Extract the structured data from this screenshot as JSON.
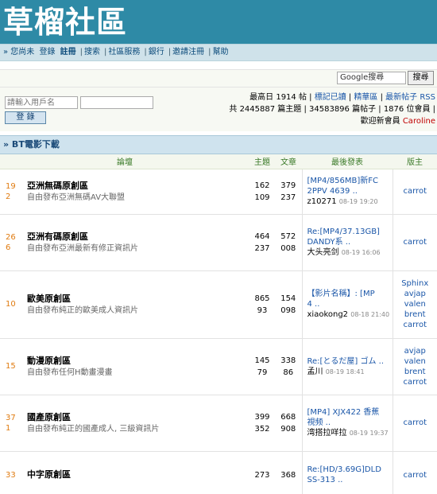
{
  "header": {
    "logo": "草榴社區"
  },
  "nav": {
    "greeting": "» 您尚未",
    "login": "登錄",
    "register": "註冊",
    "links": [
      "搜索",
      "社區服務",
      "銀行",
      "邀請注冊",
      "幫助"
    ]
  },
  "search": {
    "placeholder": "Google搜尋",
    "button": "搜尋"
  },
  "login": {
    "username_placeholder": "請輸入用戶名",
    "password_value": "",
    "button": "登 錄"
  },
  "stats": {
    "line1": "最高日 1914 帖 |",
    "link_attend": "標記已讀",
    "link_essence": "精華區",
    "link_newest": "最新帖子 RSS",
    "line2": "共 2445887 篇主題 | 34583896 篇帖子 | 1876 位會員 |",
    "welcome": "歡迎新會員",
    "new_member": "Caroline"
  },
  "section": {
    "title": "» BT電影下載"
  },
  "columns": {
    "forum": "論壇",
    "topics": "主題",
    "posts": "文章",
    "last": "最後發表",
    "mod": "版主"
  },
  "forums": [
    {
      "icon": [
        "19",
        "2"
      ],
      "name": "亞洲無碼原創區",
      "desc": "自由發布亞洲無碼AV大聯盟",
      "topics": [
        "162",
        "109"
      ],
      "posts": [
        "379",
        "237"
      ],
      "last": [
        "[MP4/856MB]新FC",
        "2PPV 4639 .."
      ],
      "last_user": "z10271",
      "last_date": "08-19 19:20",
      "mods": [
        "carrot"
      ]
    },
    {
      "icon": [
        "26",
        "6"
      ],
      "name": "亞洲有碼原創區",
      "desc": "自由發布亞洲最新有修正資訊片",
      "topics": [
        "464",
        "237"
      ],
      "posts": [
        "572",
        "008"
      ],
      "last": [
        "Re:[MP4/37.13GB]",
        "DANDY系 .."
      ],
      "last_user": "大头亮剑",
      "last_date": "08-19 16:06",
      "mods": [
        "carrot"
      ]
    },
    {
      "icon": [
        "10"
      ],
      "name": "歐美原創區",
      "desc": "自由發布純正的歐美成人資訊片",
      "topics": [
        "865",
        "93"
      ],
      "posts": [
        "154",
        "098"
      ],
      "last": [
        "【影片名稱】: [MP",
        "4 .."
      ],
      "last_user": "xiaokong2",
      "last_date": "08-18 21:40",
      "mods": [
        "Sphinx",
        "avjap",
        "valen",
        "brent",
        "carrot"
      ]
    },
    {
      "icon": [
        "15"
      ],
      "name": "動漫原創區",
      "desc": "自由發布任何H動畫漫畫",
      "topics": [
        "145",
        "79"
      ],
      "posts": [
        "338",
        "86"
      ],
      "last": [
        "Re:[とるだ屋] ゴム .."
      ],
      "last_user": "孟川",
      "last_date": "08-19 18:41",
      "mods": [
        "avjap",
        "valen",
        "brent",
        "carrot"
      ]
    },
    {
      "icon": [
        "37",
        "1"
      ],
      "name": "國產原創區",
      "desc": "自由發布純正的國產成人, 三級資訊片",
      "topics": [
        "399",
        "352"
      ],
      "posts": [
        "668",
        "908"
      ],
      "last": [
        "[MP4] XJX422 香蕉",
        "視频 .."
      ],
      "last_user": "湾搭拉咩拉",
      "last_date": "08-19 19:37",
      "mods": [
        "carrot"
      ]
    },
    {
      "icon": [
        "33"
      ],
      "name": "中字原創區",
      "desc": "",
      "topics": [
        "273",
        ""
      ],
      "posts": [
        "368",
        ""
      ],
      "last": [
        "Re:[HD/3.69G]DLD",
        "SS-313 .."
      ],
      "last_user": "",
      "last_date": "",
      "mods": [
        "carrot"
      ]
    }
  ]
}
